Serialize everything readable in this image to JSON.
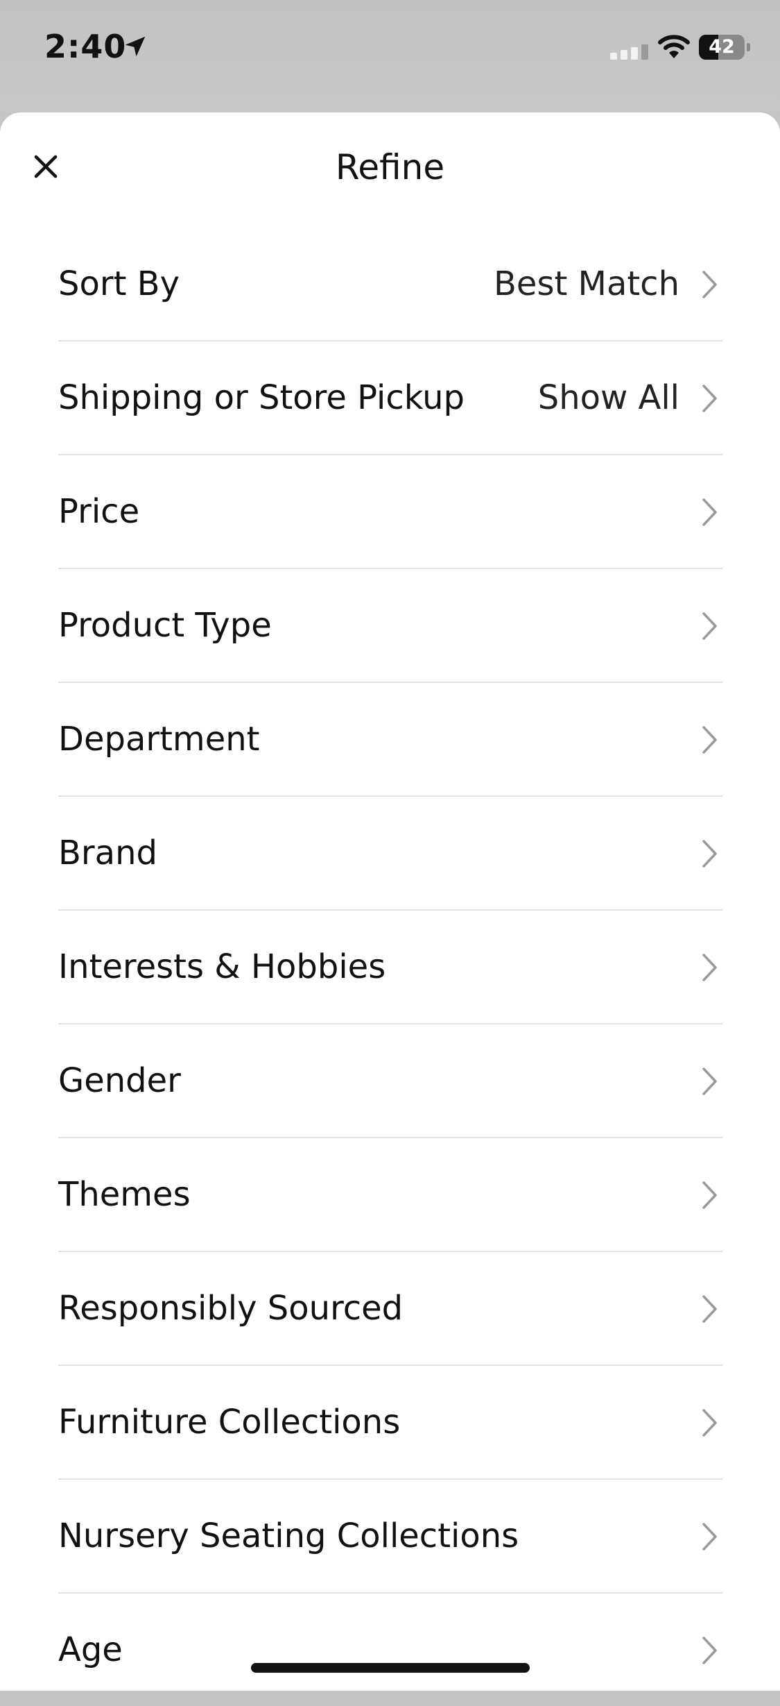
{
  "status_bar": {
    "time": "2:40",
    "battery_level": "42",
    "battery_fraction": 0.42
  },
  "header": {
    "title": "Refine",
    "close_icon": "close-icon"
  },
  "filters": [
    {
      "label": "Sort By",
      "value": "Best Match"
    },
    {
      "label": "Shipping or Store Pickup",
      "value": "Show All"
    },
    {
      "label": "Price",
      "value": ""
    },
    {
      "label": "Product Type",
      "value": ""
    },
    {
      "label": "Department",
      "value": ""
    },
    {
      "label": "Brand",
      "value": ""
    },
    {
      "label": "Interests & Hobbies",
      "value": ""
    },
    {
      "label": "Gender",
      "value": ""
    },
    {
      "label": "Themes",
      "value": ""
    },
    {
      "label": "Responsibly Sourced",
      "value": ""
    },
    {
      "label": "Furniture Collections",
      "value": ""
    },
    {
      "label": "Nursery Seating Collections",
      "value": ""
    },
    {
      "label": "Age",
      "value": ""
    }
  ],
  "colors": {
    "sheet_background": "#ffffff",
    "backdrop": "#c5c6c4",
    "text": "#111111",
    "divider": "#e3e3e3",
    "chevron": "#9a9a9a"
  }
}
